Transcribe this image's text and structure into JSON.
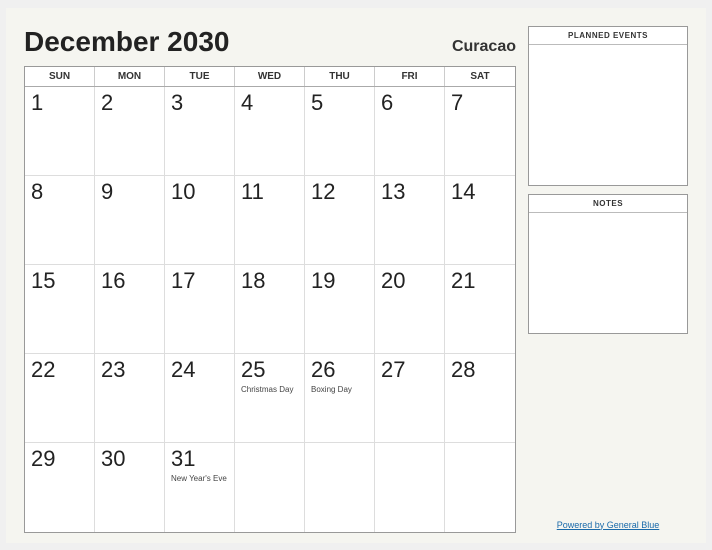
{
  "header": {
    "title": "December 2030",
    "location": "Curacao"
  },
  "day_headers": [
    "SUN",
    "MON",
    "TUE",
    "WED",
    "THU",
    "FRI",
    "SAT"
  ],
  "weeks": [
    [
      {
        "day": "1",
        "event": ""
      },
      {
        "day": "2",
        "event": ""
      },
      {
        "day": "3",
        "event": ""
      },
      {
        "day": "4",
        "event": ""
      },
      {
        "day": "5",
        "event": ""
      },
      {
        "day": "6",
        "event": ""
      },
      {
        "day": "7",
        "event": ""
      }
    ],
    [
      {
        "day": "8",
        "event": ""
      },
      {
        "day": "9",
        "event": ""
      },
      {
        "day": "10",
        "event": ""
      },
      {
        "day": "11",
        "event": ""
      },
      {
        "day": "12",
        "event": ""
      },
      {
        "day": "13",
        "event": ""
      },
      {
        "day": "14",
        "event": ""
      }
    ],
    [
      {
        "day": "15",
        "event": ""
      },
      {
        "day": "16",
        "event": ""
      },
      {
        "day": "17",
        "event": ""
      },
      {
        "day": "18",
        "event": ""
      },
      {
        "day": "19",
        "event": ""
      },
      {
        "day": "20",
        "event": ""
      },
      {
        "day": "21",
        "event": ""
      }
    ],
    [
      {
        "day": "22",
        "event": ""
      },
      {
        "day": "23",
        "event": ""
      },
      {
        "day": "24",
        "event": ""
      },
      {
        "day": "25",
        "event": "Christmas Day"
      },
      {
        "day": "26",
        "event": "Boxing Day"
      },
      {
        "day": "27",
        "event": ""
      },
      {
        "day": "28",
        "event": ""
      }
    ],
    [
      {
        "day": "29",
        "event": ""
      },
      {
        "day": "30",
        "event": ""
      },
      {
        "day": "31",
        "event": "New Year's Eve"
      },
      {
        "day": "",
        "event": ""
      },
      {
        "day": "",
        "event": ""
      },
      {
        "day": "",
        "event": ""
      },
      {
        "day": "",
        "event": ""
      }
    ]
  ],
  "sidebar": {
    "planned_events_label": "PLANNED EVENTS",
    "notes_label": "NOTES"
  },
  "footer": {
    "powered_by": "Powered by General Blue",
    "link": "#"
  }
}
